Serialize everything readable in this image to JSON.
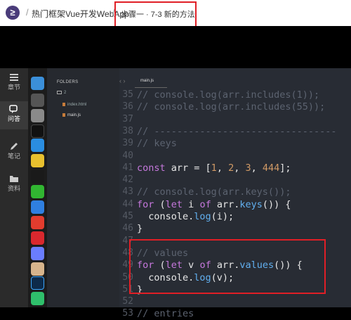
{
  "header": {
    "logo_text": "≥",
    "course_title": "热门框架Vue开发WebApp",
    "separator": "/",
    "step_title": "步骤一 · 7-3 新的方法"
  },
  "leftnav": {
    "items": [
      {
        "label": "章节",
        "icon": "list-icon"
      },
      {
        "label": "问答",
        "icon": "chat-icon"
      },
      {
        "label": "笔记",
        "icon": "pencil-icon"
      },
      {
        "label": "资料",
        "icon": "folder-icon"
      }
    ]
  },
  "sidebar": {
    "title": "FOLDERS",
    "folder": "2",
    "files": [
      "index.html",
      "main.js"
    ]
  },
  "editor": {
    "tab": "main.js",
    "lines": [
      {
        "n": "35",
        "tokens": [
          [
            "c",
            "// console.log(arr.includes(1));"
          ]
        ]
      },
      {
        "n": "36",
        "tokens": [
          [
            "c",
            "// console.log(arr.includes(55));"
          ]
        ]
      },
      {
        "n": "37",
        "tokens": []
      },
      {
        "n": "38",
        "tokens": [
          [
            "c",
            "// --------------------------------"
          ]
        ]
      },
      {
        "n": "39",
        "tokens": [
          [
            "c",
            "// keys"
          ]
        ]
      },
      {
        "n": "40",
        "tokens": []
      },
      {
        "n": "41",
        "tokens": [
          [
            "k",
            "const"
          ],
          [
            "v",
            " arr = ["
          ],
          [
            "n",
            "1"
          ],
          [
            "v",
            ", "
          ],
          [
            "n",
            "2"
          ],
          [
            "v",
            ", "
          ],
          [
            "n",
            "3"
          ],
          [
            "v",
            ", "
          ],
          [
            "n",
            "444"
          ],
          [
            "v",
            "];"
          ]
        ]
      },
      {
        "n": "42",
        "tokens": []
      },
      {
        "n": "43",
        "tokens": [
          [
            "c",
            "// console.log(arr.keys());"
          ]
        ]
      },
      {
        "n": "44",
        "tokens": [
          [
            "k",
            "for"
          ],
          [
            "v",
            " ("
          ],
          [
            "k",
            "let"
          ],
          [
            "v",
            " i "
          ],
          [
            "k",
            "of"
          ],
          [
            "v",
            " arr."
          ],
          [
            "f",
            "keys"
          ],
          [
            "v",
            "()) {"
          ]
        ]
      },
      {
        "n": "45",
        "tokens": [
          [
            "v",
            "  console."
          ],
          [
            "f",
            "log"
          ],
          [
            "v",
            "(i);"
          ]
        ]
      },
      {
        "n": "46",
        "tokens": [
          [
            "v",
            "}"
          ]
        ]
      },
      {
        "n": "47",
        "tokens": []
      },
      {
        "n": "48",
        "tokens": [
          [
            "c",
            "// values"
          ]
        ]
      },
      {
        "n": "49",
        "tokens": [
          [
            "k",
            "for"
          ],
          [
            "v",
            " ("
          ],
          [
            "k",
            "let"
          ],
          [
            "v",
            " v "
          ],
          [
            "k",
            "of"
          ],
          [
            "v",
            " arr."
          ],
          [
            "f",
            "values"
          ],
          [
            "v",
            "()) {"
          ]
        ]
      },
      {
        "n": "50",
        "tokens": [
          [
            "v",
            "  console."
          ],
          [
            "f",
            "log"
          ],
          [
            "v",
            "(v);"
          ]
        ]
      },
      {
        "n": "51",
        "tokens": [
          [
            "v",
            "}"
          ]
        ]
      },
      {
        "n": "52",
        "tokens": []
      },
      {
        "n": "53",
        "tokens": [
          [
            "c",
            "// entries"
          ]
        ]
      }
    ]
  }
}
